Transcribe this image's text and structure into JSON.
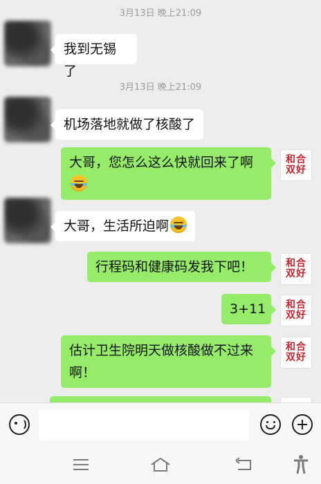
{
  "chat": {
    "timestamps": [
      "3月13日 晚上21:09",
      "3月13日 晚上21:09"
    ],
    "messages": [
      {
        "sender": "contact",
        "text": "我到无锡了"
      },
      {
        "sender": "contact",
        "text": "机场落地就做了核酸了"
      },
      {
        "sender": "me",
        "text": "大哥，您怎么这么快就回来了啊",
        "emoji": "face-with-tears-of-joy"
      },
      {
        "sender": "contact",
        "text": "大哥，生活所迫啊",
        "emoji": "face-with-tears-of-joy"
      },
      {
        "sender": "me",
        "text": "行程码和健康码发我下吧！"
      },
      {
        "sender": "me",
        "text": "3+11"
      },
      {
        "sender": "me",
        "text": "估计卫生院明天做核酸做不过来啊！"
      }
    ],
    "my_avatar_text": [
      "和合",
      "双好"
    ]
  },
  "input_bar": {
    "placeholder": "",
    "icons": [
      "voice-icon",
      "emoji-icon",
      "plus-icon"
    ]
  },
  "system_nav": {
    "icons": [
      "menu-icon",
      "home-icon",
      "back-icon",
      "accessibility-icon"
    ]
  },
  "colors": {
    "background": "#ededed",
    "outgoing_bubble": "#95ec69",
    "incoming_bubble": "#ffffff",
    "avatar_seal_red": "#c8232c"
  }
}
